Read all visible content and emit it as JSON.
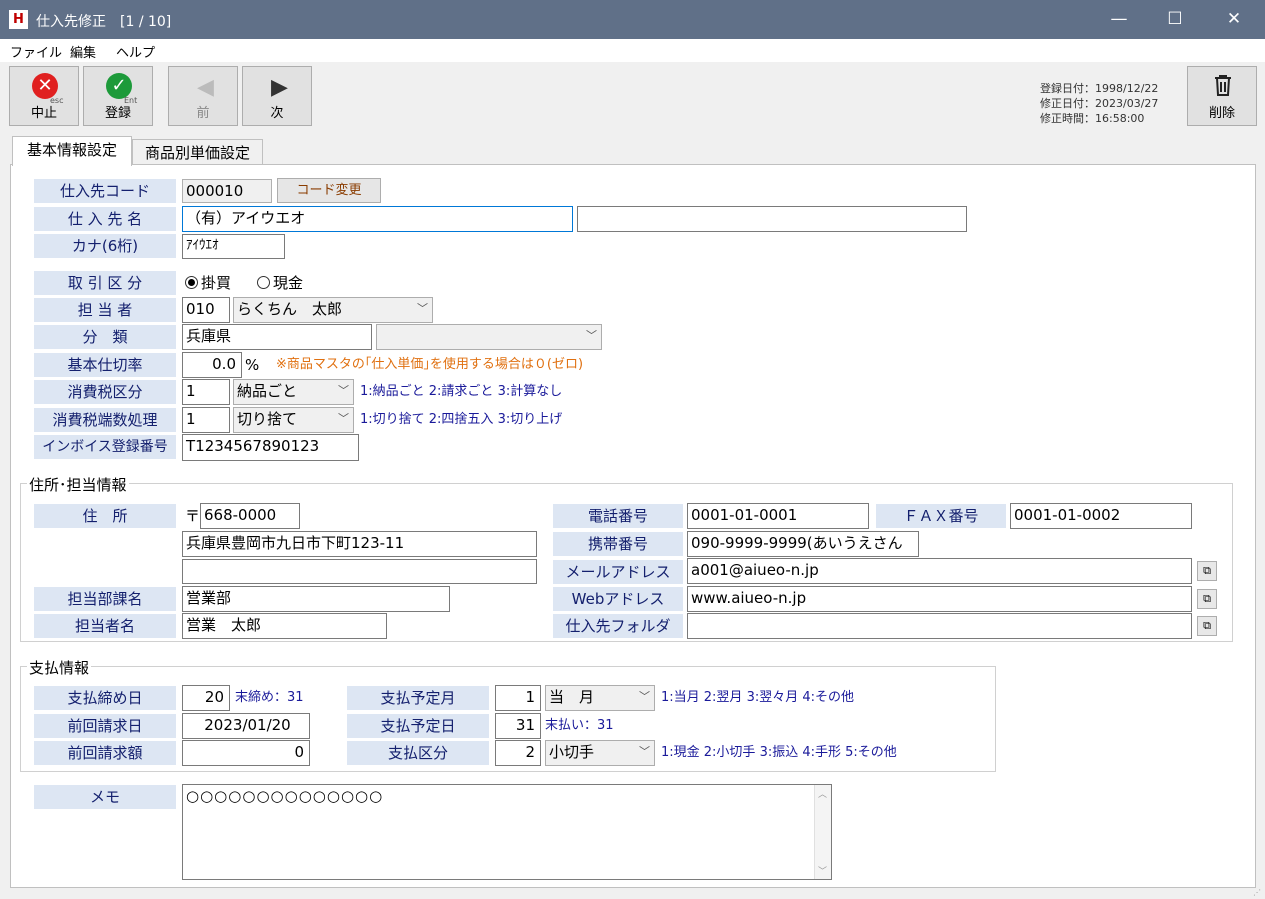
{
  "window": {
    "icon": "H",
    "title": "仕入先修正　[1 / 10]",
    "minimize": "—",
    "maximize": "☐",
    "close": "✕"
  },
  "menu": [
    "ファイル",
    "編集",
    "ヘルプ"
  ],
  "toolbar": {
    "cancel": {
      "label": "中止",
      "sub": "esc",
      "icon": "cancel-icon"
    },
    "register": {
      "label": "登録",
      "sub": "Ent",
      "icon": "check-icon"
    },
    "prev": {
      "label": "前",
      "icon": "prev-arrow-icon"
    },
    "next": {
      "label": "次",
      "icon": "next-arrow-icon"
    },
    "delete": {
      "label": "削除",
      "icon": "trash-icon"
    },
    "dates": {
      "registered": "登録日付：1998/12/22",
      "modified": "修正日付：2023/03/27",
      "modified_time": "修正時間：16:58:00"
    }
  },
  "tabs": [
    "基本情報設定",
    "商品別単価設定"
  ],
  "basic": {
    "code_label": "仕入先コード",
    "code": "000010",
    "code_change_btn": "コード変更",
    "name_label": "仕 入 先 名",
    "name": "（有）アイウエオ",
    "name2": "",
    "kana_label": "カナ(6桁)",
    "kana": "ｱｲｳｴｵ",
    "trade_label": "取 引 区 分",
    "trade_options": [
      "掛買",
      "現金"
    ],
    "trade_selected": "掛買",
    "staff_label": "担 当 者",
    "staff_code": "010",
    "staff_name": "らくちん　太郎",
    "category_label": "分　類",
    "category": "兵庫県",
    "category_select": "",
    "rate_label": "基本仕切率",
    "rate": "0.0",
    "rate_unit": "%",
    "rate_note": "※商品マスタの｢仕入単価｣を使用する場合は０(ゼロ)",
    "tax_label": "消費税区分",
    "tax_code": "1",
    "tax_select": "納品ごと",
    "tax_hint": "1:納品ごと 2:請求ごと 3:計算なし",
    "round_label": "消費税端数処理",
    "round_code": "1",
    "round_select": "切り捨て",
    "round_hint": "1:切り捨て 2:四捨五入 3:切り上げ",
    "invoice_label": "インボイス登録番号",
    "invoice": "T1234567890123"
  },
  "address": {
    "group_title": "住所･担当情報",
    "addr_label": "住　所",
    "postal_mark": "〒",
    "postal": "668-0000",
    "addr1": "兵庫県豊岡市九日市下町123-11",
    "addr2": "",
    "dept_label": "担当部課名",
    "dept": "営業部",
    "person_label": "担当者名",
    "person": "営業　太郎",
    "tel_label": "電話番号",
    "tel": "0001-01-0001",
    "fax_label": "ＦＡＸ番号",
    "fax": "0001-01-0002",
    "mobile_label": "携帯番号",
    "mobile": "090-9999-9999(あいうえさん",
    "mail_label": "メールアドレス",
    "mail": "a001@aiueo-n.jp",
    "web_label": "Webアドレス",
    "web": "www.aiueo-n.jp",
    "folder_label": "仕入先フォルダ",
    "folder": "",
    "copy_icon": "⧉"
  },
  "payment": {
    "group_title": "支払情報",
    "closing_label": "支払締め日",
    "closing": "20",
    "closing_hint": "末締め：31",
    "last_bill_date_label": "前回請求日",
    "last_bill_date": "2023/01/20",
    "last_bill_amount_label": "前回請求額",
    "last_bill_amount": "0",
    "pay_month_label": "支払予定月",
    "pay_month_code": "1",
    "pay_month_select": "当　月",
    "pay_month_hint": "1:当月 2:翌月 3:翌々月 4:その他",
    "pay_day_label": "支払予定日",
    "pay_day": "31",
    "pay_day_hint": "末払い：31",
    "pay_type_label": "支払区分",
    "pay_type_code": "2",
    "pay_type_select": "小切手",
    "pay_type_hint": "1:現金 2:小切手 3:振込 4:手形 5:その他"
  },
  "memo": {
    "label": "メモ",
    "text": "○○○○○○○○○○○○○○"
  }
}
